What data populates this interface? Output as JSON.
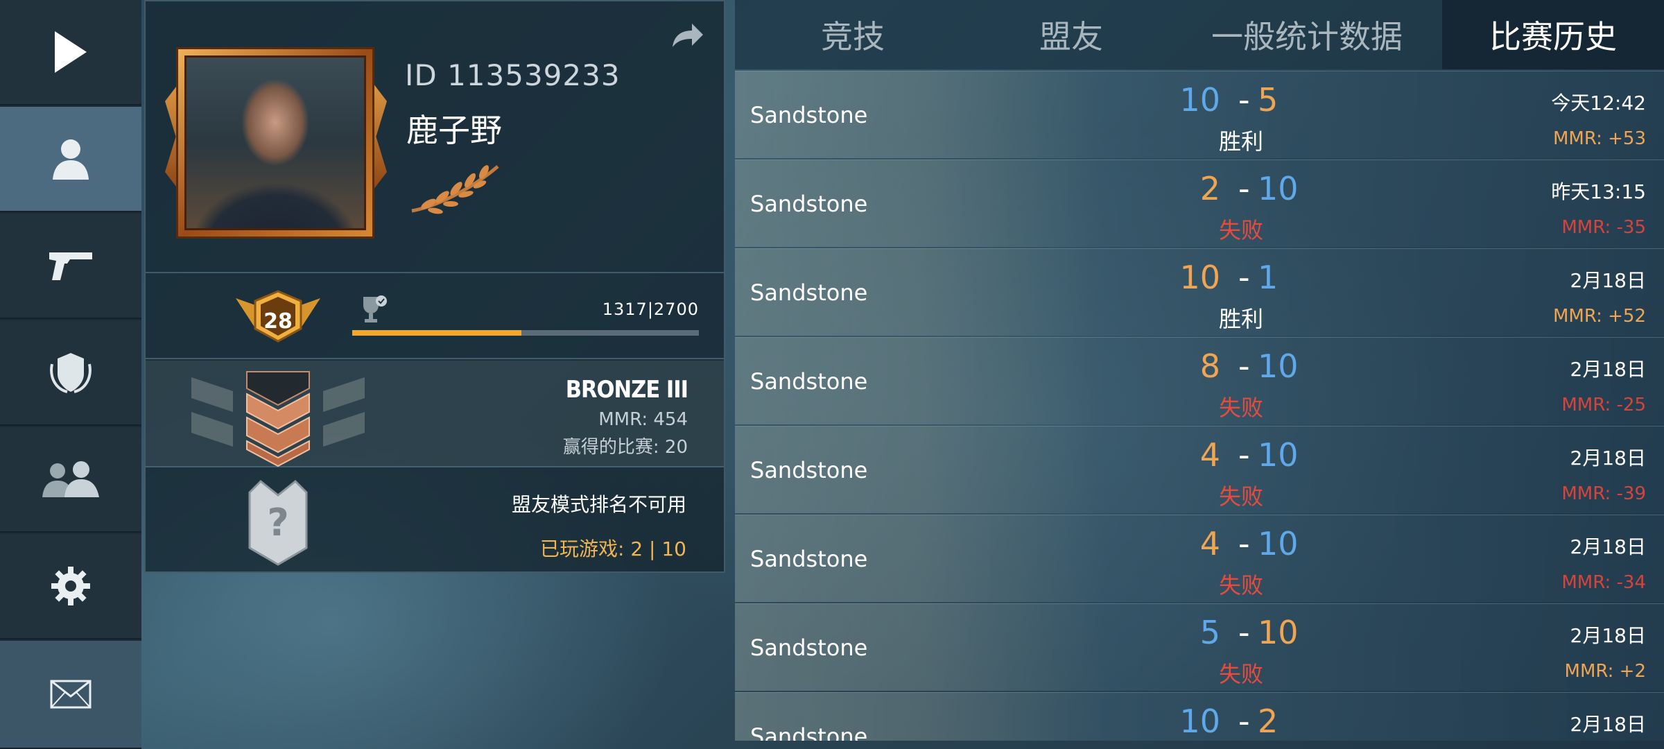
{
  "sidebar": {
    "items": [
      {
        "name": "play",
        "icon": "play-icon"
      },
      {
        "name": "profile",
        "icon": "person-icon",
        "active": true
      },
      {
        "name": "weapons",
        "icon": "pistol-icon"
      },
      {
        "name": "clan",
        "icon": "shield-icon"
      },
      {
        "name": "friends",
        "icon": "group-icon"
      },
      {
        "name": "settings",
        "icon": "gear-icon"
      },
      {
        "name": "mail",
        "icon": "envelope-icon"
      }
    ]
  },
  "profile": {
    "id_text": "ID 113539233",
    "name": "鹿子野",
    "level": "28",
    "xp_text": "1317|2700",
    "xp_fraction": 0.4878,
    "rank_name": "BRONZE III",
    "mmr_text": "MMR: 454",
    "wins_text": "赢得的比赛: 20",
    "ally_unavailable": "盟友模式排名不可用",
    "ally_played": "已玩游戏:  2  |  10"
  },
  "tabs": [
    {
      "label": "竞技",
      "active": false
    },
    {
      "label": "盟友",
      "active": false
    },
    {
      "label": "一般统计数据",
      "active": false
    },
    {
      "label": "比赛历史",
      "active": true
    }
  ],
  "matches": [
    {
      "map": "Sandstone",
      "s1": "10",
      "s1c": "blue",
      "s2": "5",
      "s2c": "orange",
      "result": "胜利",
      "win": true,
      "time": "今天12:42",
      "mmr": "MMR: +53"
    },
    {
      "map": "Sandstone",
      "s1": "2",
      "s1c": "orange",
      "s2": "10",
      "s2c": "blue",
      "result": "失败",
      "win": false,
      "time": "昨天13:15",
      "mmr": "MMR: -35"
    },
    {
      "map": "Sandstone",
      "s1": "10",
      "s1c": "orange",
      "s2": "1",
      "s2c": "blue",
      "result": "胜利",
      "win": true,
      "time": "2月18日",
      "mmr": "MMR: +52"
    },
    {
      "map": "Sandstone",
      "s1": "8",
      "s1c": "orange",
      "s2": "10",
      "s2c": "blue",
      "result": "失败",
      "win": false,
      "time": "2月18日",
      "mmr": "MMR: -25"
    },
    {
      "map": "Sandstone",
      "s1": "4",
      "s1c": "orange",
      "s2": "10",
      "s2c": "blue",
      "result": "失败",
      "win": false,
      "time": "2月18日",
      "mmr": "MMR: -39"
    },
    {
      "map": "Sandstone",
      "s1": "4",
      "s1c": "orange",
      "s2": "10",
      "s2c": "blue",
      "result": "失败",
      "win": false,
      "time": "2月18日",
      "mmr": "MMR: -34"
    },
    {
      "map": "Sandstone",
      "s1": "5",
      "s1c": "blue",
      "s2": "10",
      "s2c": "orange",
      "result": "失败",
      "win": false,
      "time": "2月18日",
      "mmr": "MMR: +2"
    },
    {
      "map": "Sandstone",
      "s1": "10",
      "s1c": "blue",
      "s2": "2",
      "s2c": "orange",
      "result": "",
      "win": true,
      "time": "2月18日",
      "mmr": ""
    }
  ],
  "colors": {
    "accent_orange": "#f0a552",
    "accent_blue": "#5fa8ea",
    "loss_red": "#ea4a3c",
    "xp_bar": "#f0a832"
  }
}
